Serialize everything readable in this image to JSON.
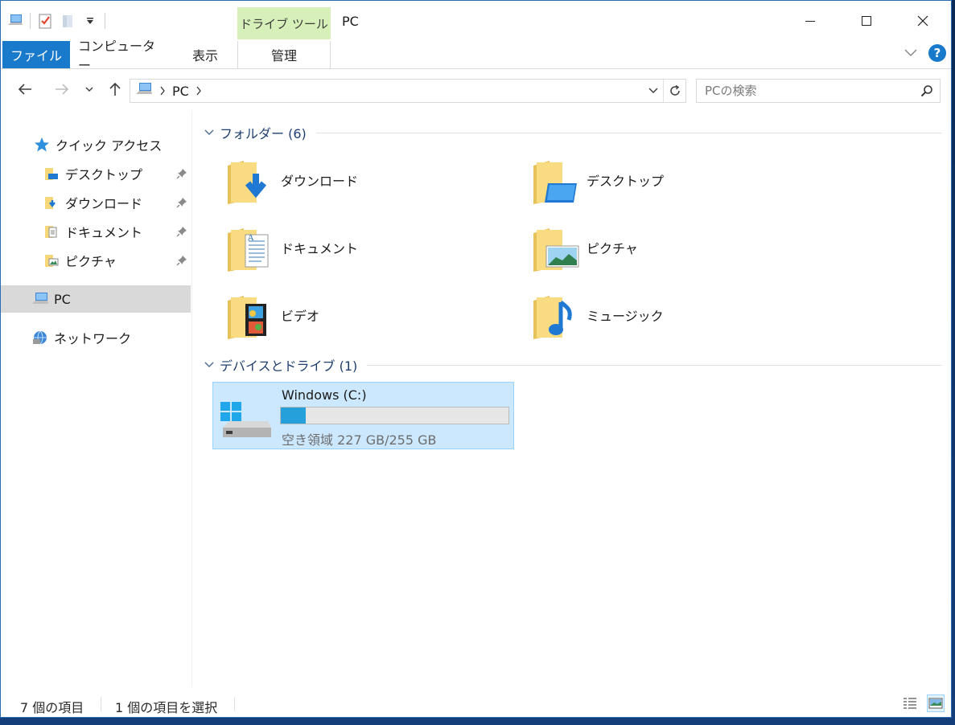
{
  "window": {
    "title": "PC",
    "context_tab_label": "ドライブ ツール"
  },
  "ribbon": {
    "tabs": {
      "file": "ファイル",
      "computer": "コンピューター",
      "view": "表示",
      "manage": "管理"
    },
    "help_label": "?"
  },
  "address": {
    "crumbs": [
      "PC"
    ],
    "search_placeholder": "PCの検索"
  },
  "nav": {
    "quick_access": "クイック アクセス",
    "pinned": [
      {
        "label": "デスクトップ",
        "icon": "desktop-folder-icon"
      },
      {
        "label": "ダウンロード",
        "icon": "downloads-folder-icon"
      },
      {
        "label": "ドキュメント",
        "icon": "documents-folder-icon"
      },
      {
        "label": "ピクチャ",
        "icon": "pictures-folder-icon"
      }
    ],
    "pc": "PC",
    "network": "ネットワーク"
  },
  "groups": {
    "folders_header": "フォルダー (6)",
    "devices_header": "デバイスとドライブ (1)"
  },
  "folders": [
    {
      "label": "ダウンロード",
      "icon": "downloads-folder-icon"
    },
    {
      "label": "デスクトップ",
      "icon": "desktop-folder-icon"
    },
    {
      "label": "ドキュメント",
      "icon": "documents-folder-icon"
    },
    {
      "label": "ピクチャ",
      "icon": "pictures-folder-icon"
    },
    {
      "label": "ビデオ",
      "icon": "videos-folder-icon"
    },
    {
      "label": "ミュージック",
      "icon": "music-folder-icon"
    }
  ],
  "drive": {
    "name": "Windows (C:)",
    "free_text": "空き領域 227 GB/255 GB",
    "used_fraction": 0.11,
    "bar_color": "#26a0da"
  },
  "status": {
    "item_count": "7 個の項目",
    "selected": "1 個の項目を選択"
  },
  "colors": {
    "accent": "#1979ca",
    "context_tab": "#d7f0b9",
    "selection": "#cce8ff"
  }
}
